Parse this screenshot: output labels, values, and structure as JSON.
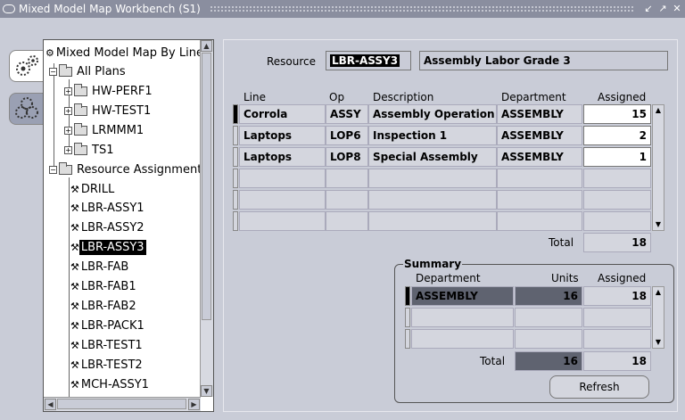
{
  "window": {
    "title": "Mixed Model Map Workbench (S1)",
    "controls": [
      "↙",
      "↗",
      "✕"
    ]
  },
  "tree": {
    "root": "Mixed Model Map By Line",
    "all_plans": "All Plans",
    "plans": [
      "HW-PERF1",
      "HW-TEST1",
      "LRMMM1",
      "TS1"
    ],
    "resource_assignment": "Resource Assignment",
    "resources": [
      "DRILL",
      "LBR-ASSY1",
      "LBR-ASSY2",
      "LBR-ASSY3",
      "LBR-FAB",
      "LBR-FAB1",
      "LBR-FAB2",
      "LBR-PACK1",
      "LBR-TEST1",
      "LBR-TEST2",
      "MCH-ASSY1"
    ],
    "selected": "LBR-ASSY3"
  },
  "resource": {
    "label": "Resource",
    "code": "LBR-ASSY3",
    "description": "Assembly Labor Grade 3"
  },
  "lines_table": {
    "headers": {
      "line": "Line",
      "op": "Op",
      "description": "Description",
      "department": "Department",
      "assigned": "Assigned"
    },
    "rows": [
      {
        "line": "Corrola",
        "op": "ASSY",
        "description": "Assembly Operation",
        "department": "ASSEMBLY",
        "assigned": "15"
      },
      {
        "line": "Laptops",
        "op": "LOP6",
        "description": "Inspection 1",
        "department": "ASSEMBLY",
        "assigned": "2"
      },
      {
        "line": "Laptops",
        "op": "LOP8",
        "description": "Special Assembly",
        "department": "ASSEMBLY",
        "assigned": "1"
      }
    ],
    "total_label": "Total",
    "total": "18"
  },
  "summary": {
    "title": "Summary",
    "headers": {
      "department": "Department",
      "units": "Units",
      "assigned": "Assigned"
    },
    "rows": [
      {
        "department": "ASSEMBLY",
        "units": "16",
        "assigned": "18"
      }
    ],
    "total_label": "Total",
    "total_units": "16",
    "total_assigned": "18"
  },
  "buttons": {
    "refresh": "Refresh"
  }
}
